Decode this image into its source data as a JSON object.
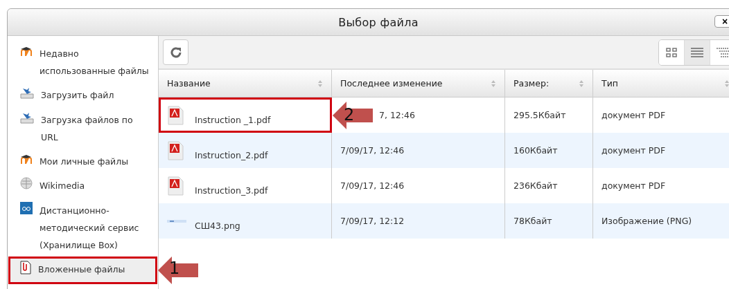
{
  "dialog": {
    "title": "Выбор файла",
    "close": "×"
  },
  "sidebar": {
    "items": [
      {
        "kind": "moodle",
        "label": "Недавно использованные файлы",
        "selected": false
      },
      {
        "kind": "upload",
        "label": "Загрузить файл",
        "selected": false
      },
      {
        "kind": "upload",
        "label": "Загрузка файлов по URL",
        "selected": false
      },
      {
        "kind": "moodle",
        "label": "Мои личные файлы",
        "selected": false
      },
      {
        "kind": "wiki",
        "label": "Wikimedia",
        "selected": false
      },
      {
        "kind": "box",
        "label": "Дистанционно-методический сервис (Хранилище Box)",
        "selected": false
      },
      {
        "kind": "attach",
        "label": "Вложенные файлы",
        "selected": true,
        "callout": "1"
      }
    ]
  },
  "views": [
    {
      "kind": "icons",
      "selected": false
    },
    {
      "kind": "list",
      "selected": true
    },
    {
      "kind": "tree",
      "selected": false
    }
  ],
  "table": {
    "columns": [
      "Название",
      "Последнее изменение",
      "Размер:",
      "Тип"
    ],
    "rows": [
      {
        "kind": "pdf",
        "name": "Instruction _1.pdf",
        "modified": "7, 12:46",
        "size": "295.5Кбайт",
        "type": "документ PDF",
        "callout": "2"
      },
      {
        "kind": "pdf",
        "name": "Instruction_2.pdf",
        "modified": "7/09/17, 12:46",
        "size": "160Кбайт",
        "type": "документ PDF"
      },
      {
        "kind": "pdf",
        "name": "Instruction_3.pdf",
        "modified": "7/09/17, 12:46",
        "size": "236Кбайт",
        "type": "документ PDF"
      },
      {
        "kind": "image",
        "name": "СШ43.png",
        "modified": "7/09/17, 12:12",
        "size": "78Кбайт",
        "type": "Изображение (PNG)"
      }
    ]
  }
}
